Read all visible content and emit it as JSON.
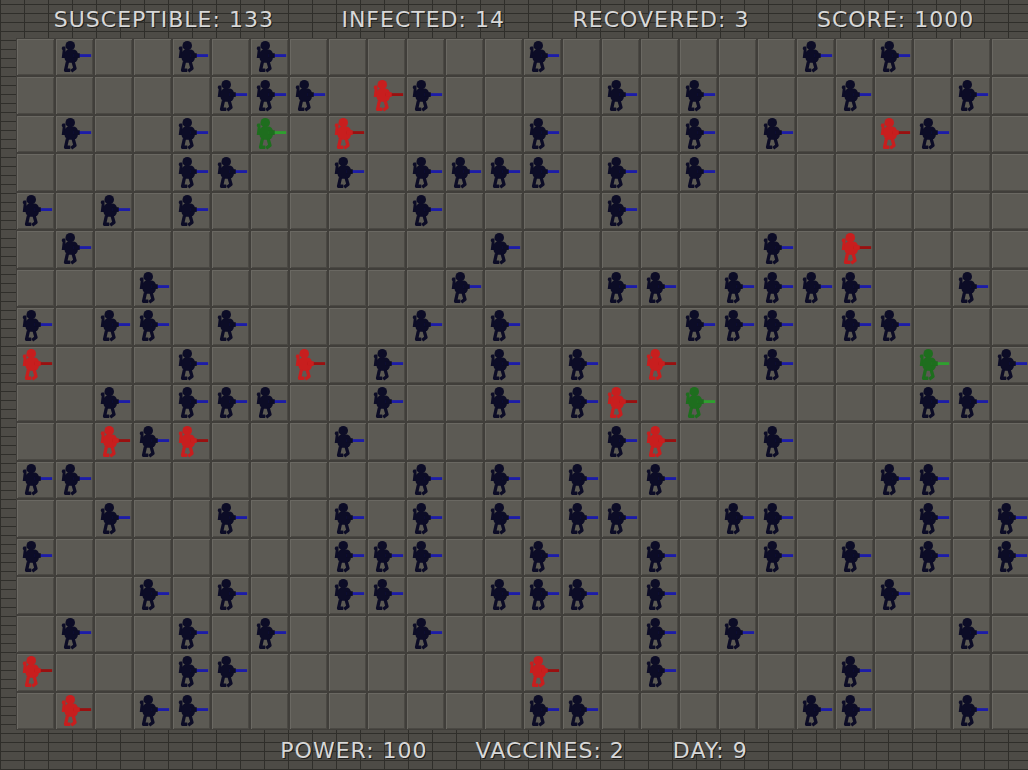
{
  "hud_top": [
    {
      "label": "SUSCEPTIBLE: 133"
    },
    {
      "label": "INFECTED: 14"
    },
    {
      "label": "RECOVERED: 3"
    },
    {
      "label": "SCORE: 1000"
    }
  ],
  "hud_bottom": [
    {
      "label": "POWER: 100"
    },
    {
      "label": "VACCINES: 2"
    },
    {
      "label": "DAY: 9"
    }
  ],
  "kinds": {
    "S": {
      "name": "susceptible",
      "color": "#0c0c26",
      "accent": "#1c1ca8"
    },
    "I": {
      "name": "infected",
      "color": "#c81e1e",
      "accent": "#9a1010"
    },
    "R": {
      "name": "recovered",
      "color": "#1e6e1e",
      "accent": "#2fa02f"
    }
  },
  "board": [
    ".S..S.S......S......S.S...",
    ".....SSS.IS....S.S...S..S.",
    ".S..S.R.I....S...S.S..IS..",
    "....SS..S.SSSS.S.S........",
    "S.S.S.....S....S..........",
    ".S..........S......S.I....",
    "...S.......S...SS.SSSS..S.",
    "S.SS.S....S.S....SSS.SS...",
    "I...S..I.S..S.S.I..S...R.S",
    "..S.SSS..S..S.SI.R.....SS.",
    "..ISI...S......SI..S......",
    "SS........S.S.S.S.....SS..",
    "..S..S..S.S.S.SS..SS...S.S",
    "S.......SSS..S..S..S.S.S.S",
    "...S.S..SS..SSS.S.....S...",
    ".S..S.S...S.....S.S.....S.",
    "I...SS.......I..S....S....",
    ".I.SS........SS.....SS..S."
  ]
}
